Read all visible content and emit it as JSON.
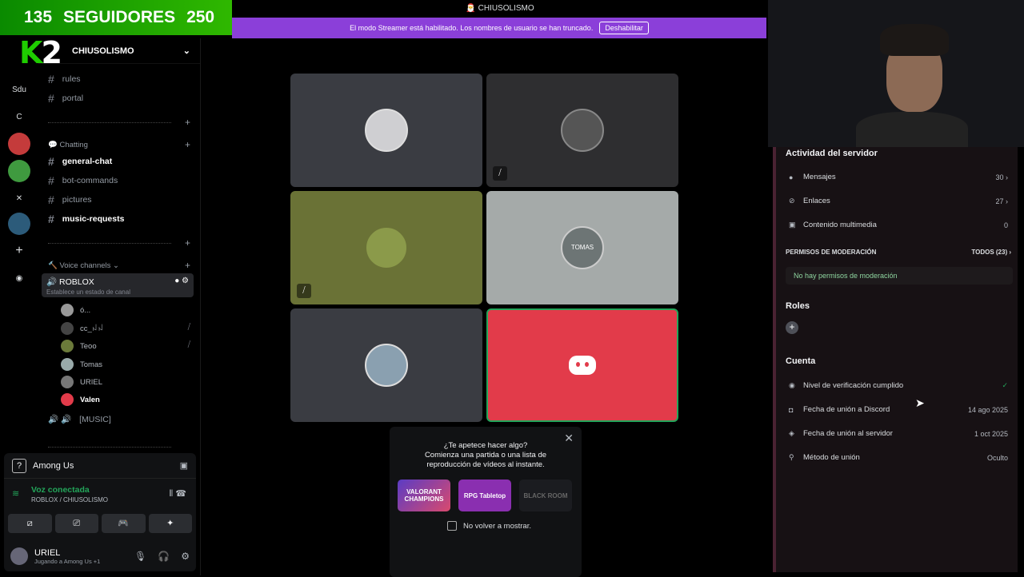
{
  "overlay": {
    "followers_current": "135",
    "followers_label": "SEGUIDORES",
    "followers_goal": "250",
    "logo_k": "K",
    "logo_2": "2"
  },
  "titlebar": {
    "title": "CHIUSOLISMO"
  },
  "streamer_banner": {
    "text": "El modo Streamer está habilitado. Los nombres de usuario se han truncado.",
    "button": "Deshabilitar"
  },
  "rail": {
    "items": [
      "Sdu",
      "C"
    ]
  },
  "server": {
    "name": "CHIUSOLISMO"
  },
  "channels": {
    "top": [
      "rules",
      "portal"
    ],
    "chatting_category": "Chatting",
    "chatting": [
      "general-chat",
      "bot-commands",
      "pictures",
      "music-requests"
    ],
    "voice_category": "Voice channels",
    "active_voice": {
      "name": "ROBLOX",
      "status": "Establece un estado de canal"
    },
    "voice_users": [
      "ó...",
      "cc_ꈤꈤ",
      "Teoo",
      "Tomas",
      "URIEL",
      "Valen"
    ],
    "music": "[MUSIC]"
  },
  "panel": {
    "game": "Among Us",
    "voice_title": "Voz conectada",
    "voice_sub": "ROBLOX / CHIUSOLISMO",
    "username": "URIEL",
    "user_status": "Jugando a Among Us +1"
  },
  "stage": {
    "tile_text": "TOMAS"
  },
  "popup": {
    "line1": "¿Te apetece hacer algo?",
    "line2": "Comienza una partida o una lista de",
    "line3": "reproducción de vídeos al instante.",
    "cards": [
      "VALORANT CHAMPIONS",
      "RPG Tabletop",
      "BLACK ROOM"
    ],
    "checkbox": "No volver a mostrar."
  },
  "right": {
    "activity_title": "Actividad del servidor",
    "activity": [
      {
        "label": "Mensajes",
        "value": "30"
      },
      {
        "label": "Enlaces",
        "value": "27"
      },
      {
        "label": "Contenido multimedia",
        "value": "0"
      }
    ],
    "mod_title": "PERMISOS DE MODERACIÓN",
    "mod_all": "TODOS (23)",
    "no_mod": "No hay permisos de moderación",
    "roles_title": "Roles",
    "account_title": "Cuenta",
    "account": [
      {
        "label": "Nivel de verificación cumplido",
        "value": "✓"
      },
      {
        "label": "Fecha de unión a Discord",
        "value": "14 ago 2025"
      },
      {
        "label": "Fecha de unión al servidor",
        "value": "1 oct 2025"
      },
      {
        "label": "Método de unión",
        "value": "Oculto"
      }
    ]
  },
  "colors": {
    "streamer": "#8b3fd9",
    "discord_tile": "#e23b4a",
    "green": "#23a55a"
  }
}
